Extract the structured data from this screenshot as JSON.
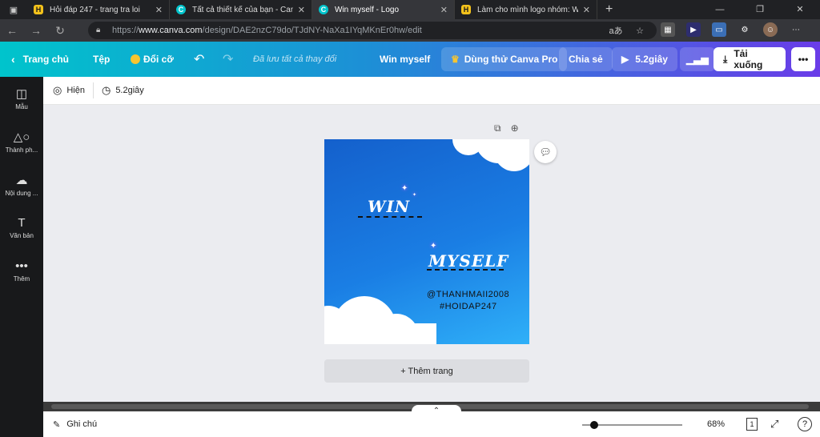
{
  "browser": {
    "tabs": [
      {
        "title": "Hỏi đáp 247 - trang tra loi",
        "icon": "h-icon",
        "active": false
      },
      {
        "title": "Tất cả thiết kế của bạn - Canva",
        "icon": "canva-icon",
        "active": false
      },
      {
        "title": "Win myself - Logo",
        "icon": "canva-icon",
        "active": true
      },
      {
        "title": "Làm cho mình logo nhóm: Win",
        "icon": "h-icon",
        "active": false
      }
    ],
    "new_tab": "+",
    "url_prefix": "https://",
    "url_domain": "www.canva.com",
    "url_path": "/design/DAE2nzC79do/TJdNY-NaXa1IYqMKnEr0hw/edit"
  },
  "editor_bar": {
    "home": "Trang chủ",
    "file": "Tệp",
    "resize": "Đổi cỡ",
    "saved": "Đã lưu tất cả thay đổi",
    "design_title": "Win myself",
    "try_pro": "Dùng thử Canva Pro",
    "share": "Chia sẻ",
    "play": "5.2giây",
    "download": "Tải xuống",
    "more": "•••"
  },
  "sidebar": {
    "items": [
      {
        "label": "Mẫu",
        "icon": "layout-icon"
      },
      {
        "label": "Thành ph...",
        "icon": "elements-icon"
      },
      {
        "label": "Nội dung ...",
        "icon": "upload-icon"
      },
      {
        "label": "Văn bản",
        "icon": "text-icon"
      },
      {
        "label": "Thêm",
        "icon": "more-icon"
      }
    ]
  },
  "toolbar": {
    "animate": "Hiện",
    "duration": "5.2giây"
  },
  "design": {
    "word1": "WIN",
    "word2": "MYSELF",
    "handle1": "@THANHMAII2008",
    "handle2": "#HOIDAP247"
  },
  "add_page": "+ Thêm trang",
  "bottom": {
    "notes": "Ghi chú",
    "zoom": "68%",
    "page_num": "1",
    "zoom_fraction": 0.08
  },
  "colors": {
    "accent_start": "#00c4cc",
    "accent_end": "#6a3ce8",
    "design_blue": "#1a7ee4"
  }
}
